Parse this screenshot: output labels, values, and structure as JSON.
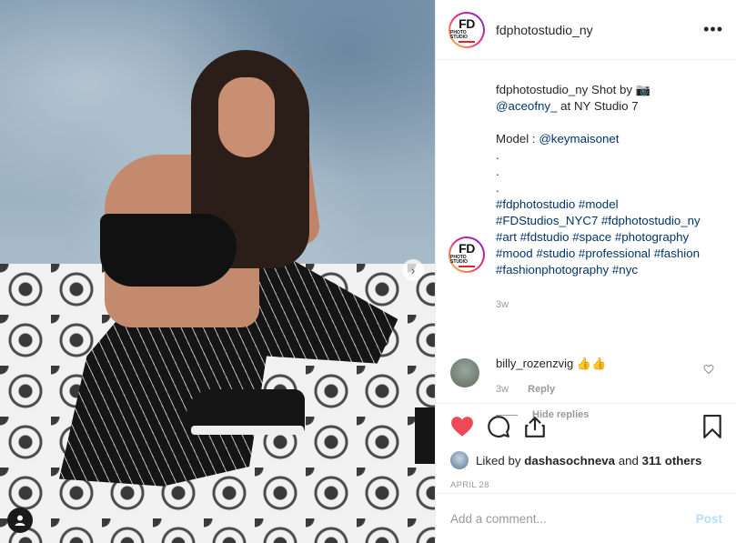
{
  "post": {
    "username": "fdphotostudio_ny",
    "more_label": "•••",
    "logo_text": "FD",
    "logo_sub": "PHOTO STUDIO"
  },
  "caption": {
    "line1_user": "fdphotostudio_ny",
    "line1_text": " Shot by 📷",
    "line2_mention": "@aceofny_",
    "line2_text": " at NY Studio 7",
    "model_label": "Model : ",
    "model_mention": "@keymaisonet",
    "dots": [
      ".",
      ".",
      "."
    ],
    "hashtags": "#fdphotostudio #model #FDStudios_NYC7 #fdphotostudio_ny #art #fdstudio #space #photography #mood #studio #professional #fashion #fashionphotography #nyc",
    "time": "3w"
  },
  "comment": {
    "username": "billy_rozenzvig",
    "text": " 👍👍",
    "time": "3w",
    "reply_label": "Reply",
    "hide_label": "Hide replies"
  },
  "actions": {
    "liked_prefix": "Liked by ",
    "liked_user": "dashasochneva",
    "liked_mid": " and ",
    "liked_count": "311 others",
    "date": "APRIL 28"
  },
  "add_comment": {
    "placeholder": "Add a comment...",
    "post_label": "Post"
  },
  "colors": {
    "like_red": "#ed4956",
    "link_blue": "#003569",
    "post_disabled": "#b2dffc"
  }
}
